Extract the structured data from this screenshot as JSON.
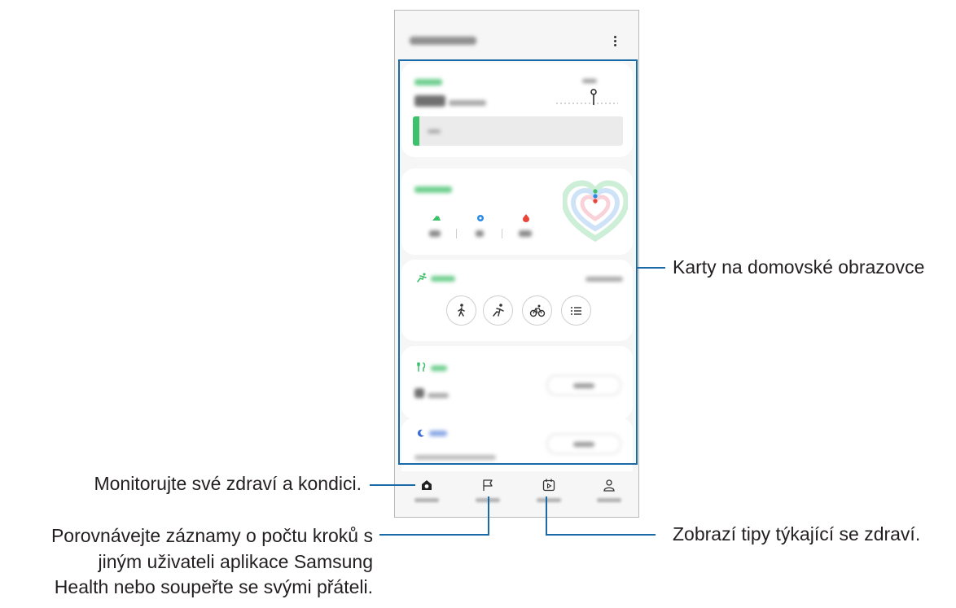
{
  "callouts": {
    "cards": "Karty na domovské obrazovce",
    "home": "Monitorujte své zdraví a kondici.",
    "tips": "Zobrazí tipy týkající se zdraví.",
    "together_line1": "Porovnávejte záznamy o počtu kroků s",
    "together_line2": "jiným uživateli aplikace Samsung",
    "together_line3": "Health nebo soupeřte se svými přáteli."
  },
  "icons": {
    "more": "more-vertical-icon",
    "shoe": "shoe-icon",
    "active_time": "clock-icon",
    "calories": "flame-icon",
    "exercise": "running-icon",
    "walk": "walking-icon",
    "run": "running-icon",
    "bike": "cycling-icon",
    "list": "list-icon",
    "food": "fork-knife-icon",
    "sleep": "moon-icon",
    "nav_home": "home-icon",
    "nav_together": "flag-icon",
    "nav_discover": "play-calendar-icon",
    "nav_profile": "person-icon"
  },
  "colors": {
    "accent_green": "#3ec16b",
    "callout_line": "#1a6aa8",
    "sleep_blue": "#3b6fd6",
    "calorie_red": "#e8443a",
    "active_blue": "#2a8ae6"
  },
  "steps": {
    "progress": 0.03
  }
}
